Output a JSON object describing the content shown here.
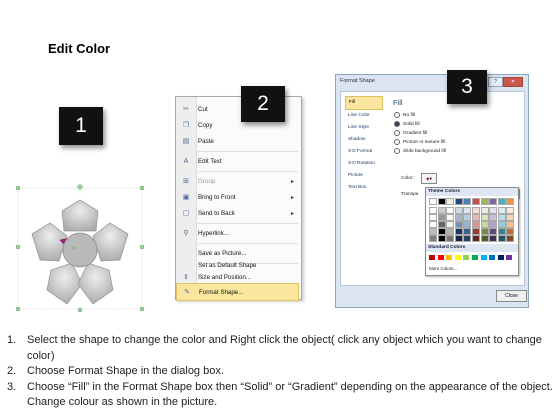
{
  "title": "Edit Color",
  "steps": [
    "1",
    "2",
    "3"
  ],
  "context_menu": {
    "items": [
      {
        "label": "Cut",
        "icon": "scissors-icon",
        "glyph": "✂"
      },
      {
        "label": "Copy",
        "icon": "copy-icon",
        "glyph": "❐"
      },
      {
        "label": "Paste",
        "icon": "paste-icon",
        "glyph": "▤"
      },
      {
        "label": "Edit Text",
        "icon": "edit-text-icon",
        "glyph": "A"
      },
      {
        "label": "Group",
        "icon": "group-icon",
        "glyph": "⊞",
        "disabled": true,
        "submenu": true
      },
      {
        "label": "Bring to Front",
        "icon": "bring-to-front-icon",
        "glyph": "▣",
        "submenu": true
      },
      {
        "label": "Send to Back",
        "icon": "send-to-back-icon",
        "glyph": "▢",
        "submenu": true
      },
      {
        "label": "Hyperlink...",
        "icon": "hyperlink-icon",
        "glyph": "🔗"
      },
      {
        "label": "Save as Picture...",
        "icon": "",
        "glyph": ""
      },
      {
        "label": "Set as Default Shape",
        "icon": "",
        "glyph": ""
      },
      {
        "label": "Size and Position...",
        "icon": "size-position-icon",
        "glyph": "⇕"
      },
      {
        "label": "Format Shape...",
        "icon": "format-shape-icon",
        "glyph": "🖌",
        "highlight": true
      }
    ]
  },
  "dialog": {
    "title": "Format Shape",
    "nav": [
      "Fill",
      "Line Color",
      "Line Style",
      "Shadow",
      "3-D Format",
      "3-D Rotation",
      "Picture",
      "Text Box"
    ],
    "selected_nav": "Fill",
    "fill_header": "Fill",
    "options": [
      "No fill",
      "Solid fill",
      "Gradient fill",
      "Picture or texture fill",
      "Slide background fill"
    ],
    "selected_option": "Solid fill",
    "color_label": "Color:",
    "transparency_label": "Transpa",
    "theme_colors_label": "Theme Colors",
    "standard_colors_label": "Standard Colors",
    "more_colors_label": "More Colors...",
    "close_label": "Close",
    "theme_colors": [
      "#ffffff",
      "#000000",
      "#eeece1",
      "#1f497d",
      "#4f81bd",
      "#c0504d",
      "#9bbb59",
      "#8064a2",
      "#4bacc6",
      "#f79646"
    ],
    "standard_colors": [
      "#c00000",
      "#ff0000",
      "#ffc000",
      "#ffff00",
      "#92d050",
      "#00b050",
      "#00b0f0",
      "#0070c0",
      "#002060",
      "#7030a0"
    ]
  },
  "instructions": [
    {
      "num": "1.",
      "text": "Select the shape to change the color and Right click the object( click any object which you want to change color)"
    },
    {
      "num": "2.",
      "text": "Choose Format Shape in the dialog box."
    },
    {
      "num": "3.",
      "text": "Choose “Fill” in the Format Shape box then “Solid” or “Gradient” depending on the appearance of the object. Change colour as shown in the picture."
    }
  ],
  "colors": {
    "highlight": "#fbe6a0",
    "dialog_bg": "#dbe5f1",
    "accent_magenta": "#a0207a"
  }
}
